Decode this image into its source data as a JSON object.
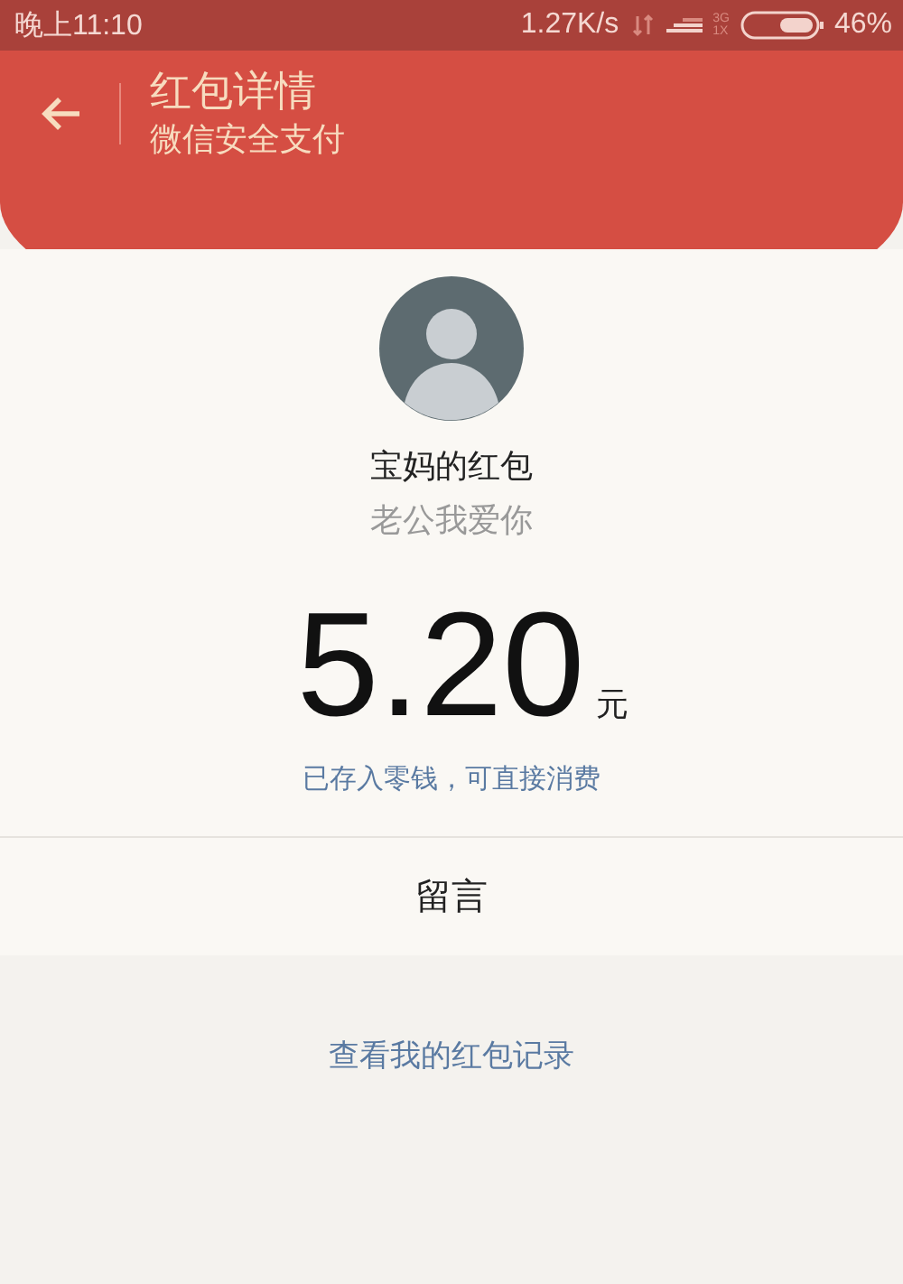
{
  "status_bar": {
    "time": "晚上11:10",
    "speed": "1.27K/s",
    "network_type": [
      "3G",
      "1X"
    ],
    "battery": "46%"
  },
  "header": {
    "title": "红包详情",
    "subtitle": "微信安全支付"
  },
  "packet": {
    "sender": "宝妈的红包",
    "message": "老公我爱你",
    "amount": "5.20",
    "unit": "元",
    "note": "已存入零钱，可直接消费"
  },
  "reply": {
    "label": "留言"
  },
  "footer": {
    "link": "查看我的红包记录"
  }
}
